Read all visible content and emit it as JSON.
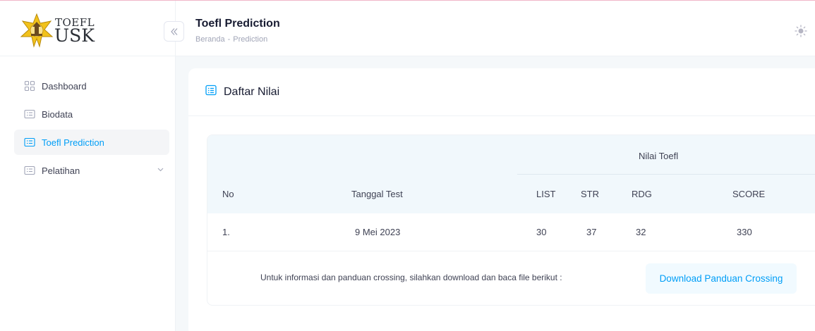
{
  "brand": {
    "logo_top": "TOEFL",
    "logo_bottom": "USK"
  },
  "sidebar": {
    "collapse_icon": "double-chevron-left-icon",
    "items": [
      {
        "label": "Dashboard",
        "icon": "grid-icon",
        "active": false
      },
      {
        "label": "Biodata",
        "icon": "list-card-icon",
        "active": false
      },
      {
        "label": "Toefl Prediction",
        "icon": "list-card-icon",
        "active": true
      },
      {
        "label": "Pelatihan",
        "icon": "list-card-icon",
        "active": false,
        "has_submenu": true
      }
    ]
  },
  "header": {
    "title": "Toefl Prediction",
    "breadcrumb": [
      "Beranda",
      "Prediction"
    ],
    "breadcrumb_sep": "-",
    "theme_icon": "sun-icon"
  },
  "card": {
    "title": "Daftar Nilai",
    "title_icon": "list-icon",
    "table": {
      "group_header": "Nilai Toefl",
      "columns": [
        "No",
        "Tanggal Test",
        "LIST",
        "STR",
        "RDG",
        "SCORE"
      ],
      "rows": [
        {
          "no": "1.",
          "date": "9 Mei 2023",
          "list": "30",
          "str": "37",
          "rdg": "32",
          "score": "330"
        }
      ]
    },
    "info_text": "Untuk informasi dan panduan crossing, silahkan download dan baca file berikut :",
    "download_label": "Download Panduan Crossing"
  },
  "colors": {
    "primary": "#009ef7",
    "table_header_bg": "#f1f8fc",
    "active_bg": "#f4f5f7"
  }
}
